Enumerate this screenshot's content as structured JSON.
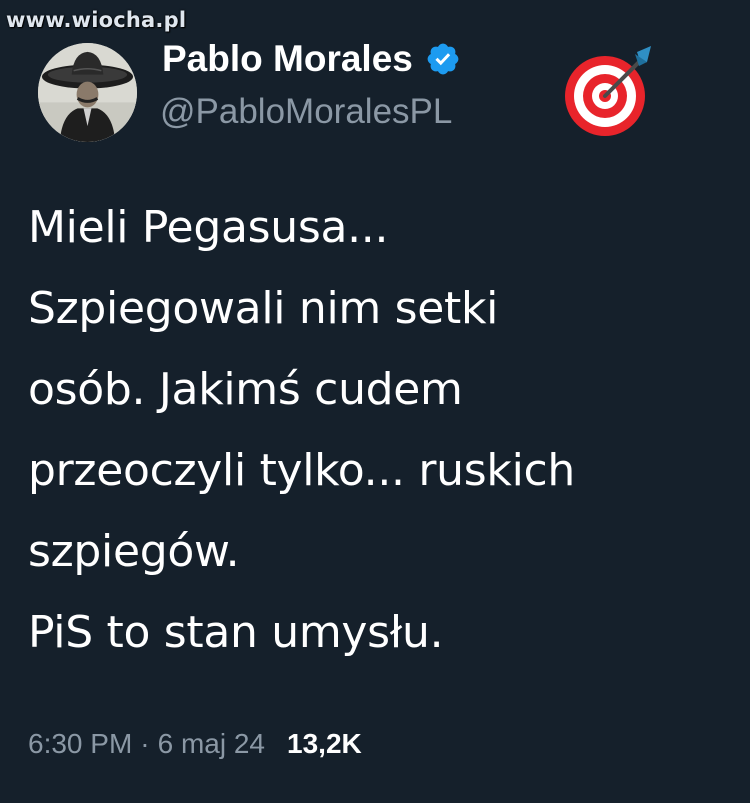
{
  "watermark": "www.wiocha.pl",
  "author": {
    "name": "Pablo Morales",
    "handle": "@PabloMoralesPL",
    "verified_icon": "verified-badge-icon",
    "emoji_icon": "direct-hit-target-icon",
    "avatar_icon": "sombrero-man-portrait"
  },
  "tweet": {
    "lines": [
      "Mieli Pegasusa...",
      "Szpiegowali nim setki",
      "osób. Jakimś cudem",
      "przeoczyli tylko... ruskich",
      "szpiegów.",
      "PiS to stan umysłu."
    ]
  },
  "meta": {
    "time": "6:30 PM",
    "separator": "·",
    "date": "6 maj 24",
    "views": "13,2K"
  },
  "colors": {
    "background": "#15202b",
    "text": "#ffffff",
    "secondary_text": "#8b98a5",
    "verified_blue": "#1d9bf0"
  }
}
